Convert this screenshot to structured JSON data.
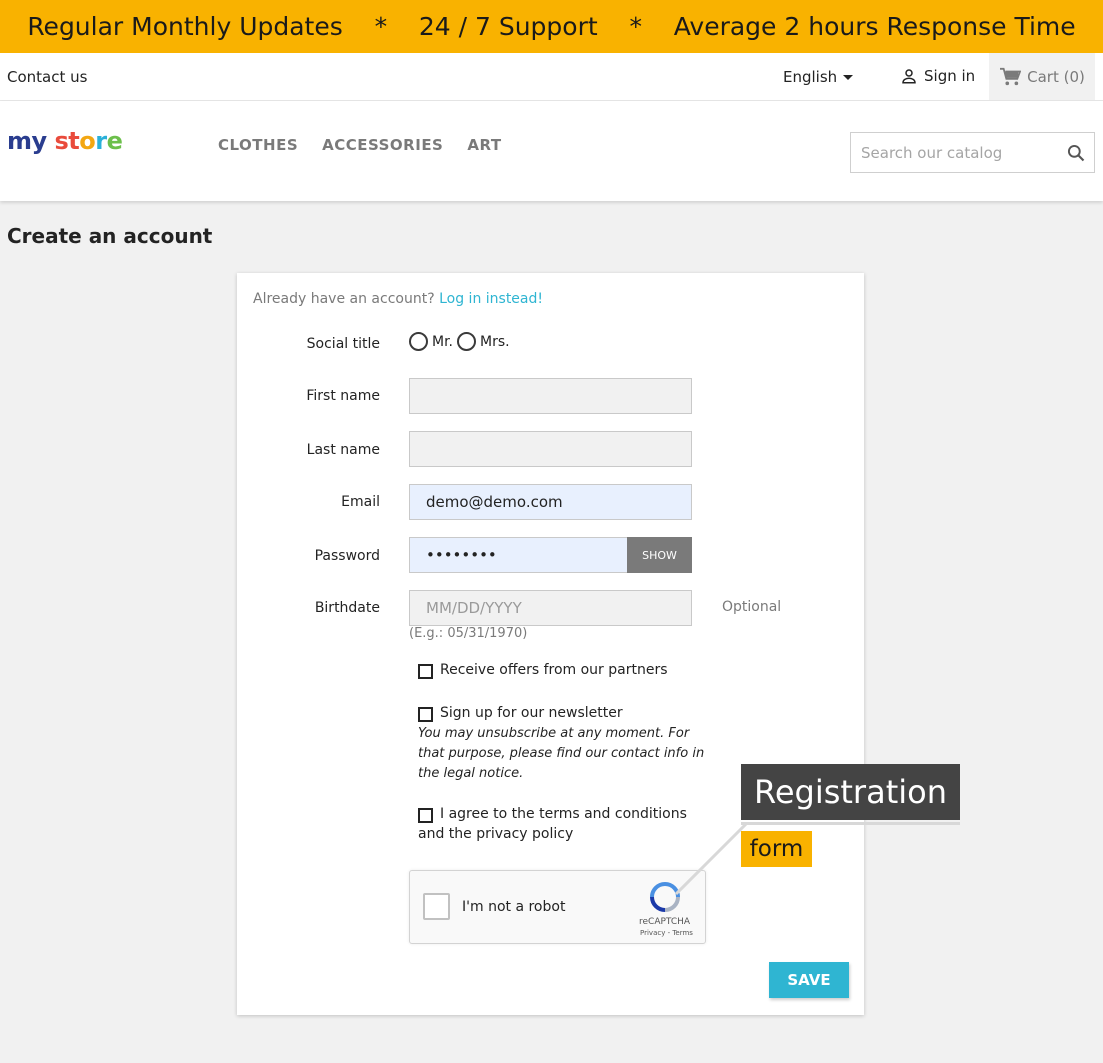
{
  "banner": {
    "item1": "Regular Monthly Updates",
    "sep1": "*",
    "item2": "24 / 7 Support",
    "sep2": "*",
    "item3": "Average 2 hours Response Time"
  },
  "topnav": {
    "contact": "Contact us",
    "language": "English",
    "signin": "Sign in",
    "cart": "Cart (0)"
  },
  "header": {
    "logo_part1": "my",
    "logo_part2": "st",
    "logo_part3": "o",
    "logo_part4": "r",
    "logo_part5": "e",
    "menu": [
      "CLOTHES",
      "ACCESSORIES",
      "ART"
    ],
    "search_placeholder": "Search our catalog"
  },
  "page": {
    "title": "Create an account"
  },
  "form": {
    "already_text": "Already have an account?",
    "login_link": "Log in instead!",
    "social_title_label": "Social title",
    "mr": "Mr.",
    "mrs": "Mrs.",
    "first_name_label": "First name",
    "first_name_value": "",
    "last_name_label": "Last name",
    "last_name_value": "",
    "email_label": "Email",
    "email_value": "demo@demo.com",
    "password_label": "Password",
    "password_value": "••••••••",
    "show_button": "SHOW",
    "birthdate_label": "Birthdate",
    "birthdate_placeholder": "MM/DD/YYYY",
    "birthdate_optional": "Optional",
    "birthdate_hint": "(E.g.: 05/31/1970)",
    "offers_label": "Receive offers from our partners",
    "newsletter_label": "Sign up for our newsletter",
    "newsletter_note": "You may unsubscribe at any moment. For that purpose, please find our contact info in the legal notice.",
    "terms_label_line1": "I agree to the terms and conditions",
    "terms_label_line2": "and the privacy policy",
    "captcha_text": "I'm not a robot",
    "captcha_brand": "reCAPTCHA",
    "captcha_terms": "Privacy - Terms",
    "save_button": "SAVE"
  },
  "annotation": {
    "title": "Registration",
    "subtitle": "form"
  },
  "colors": {
    "accent": "#f9b200",
    "link": "#2fb5d2",
    "save": "#2fb5d2",
    "annotation_dark": "#444444"
  }
}
